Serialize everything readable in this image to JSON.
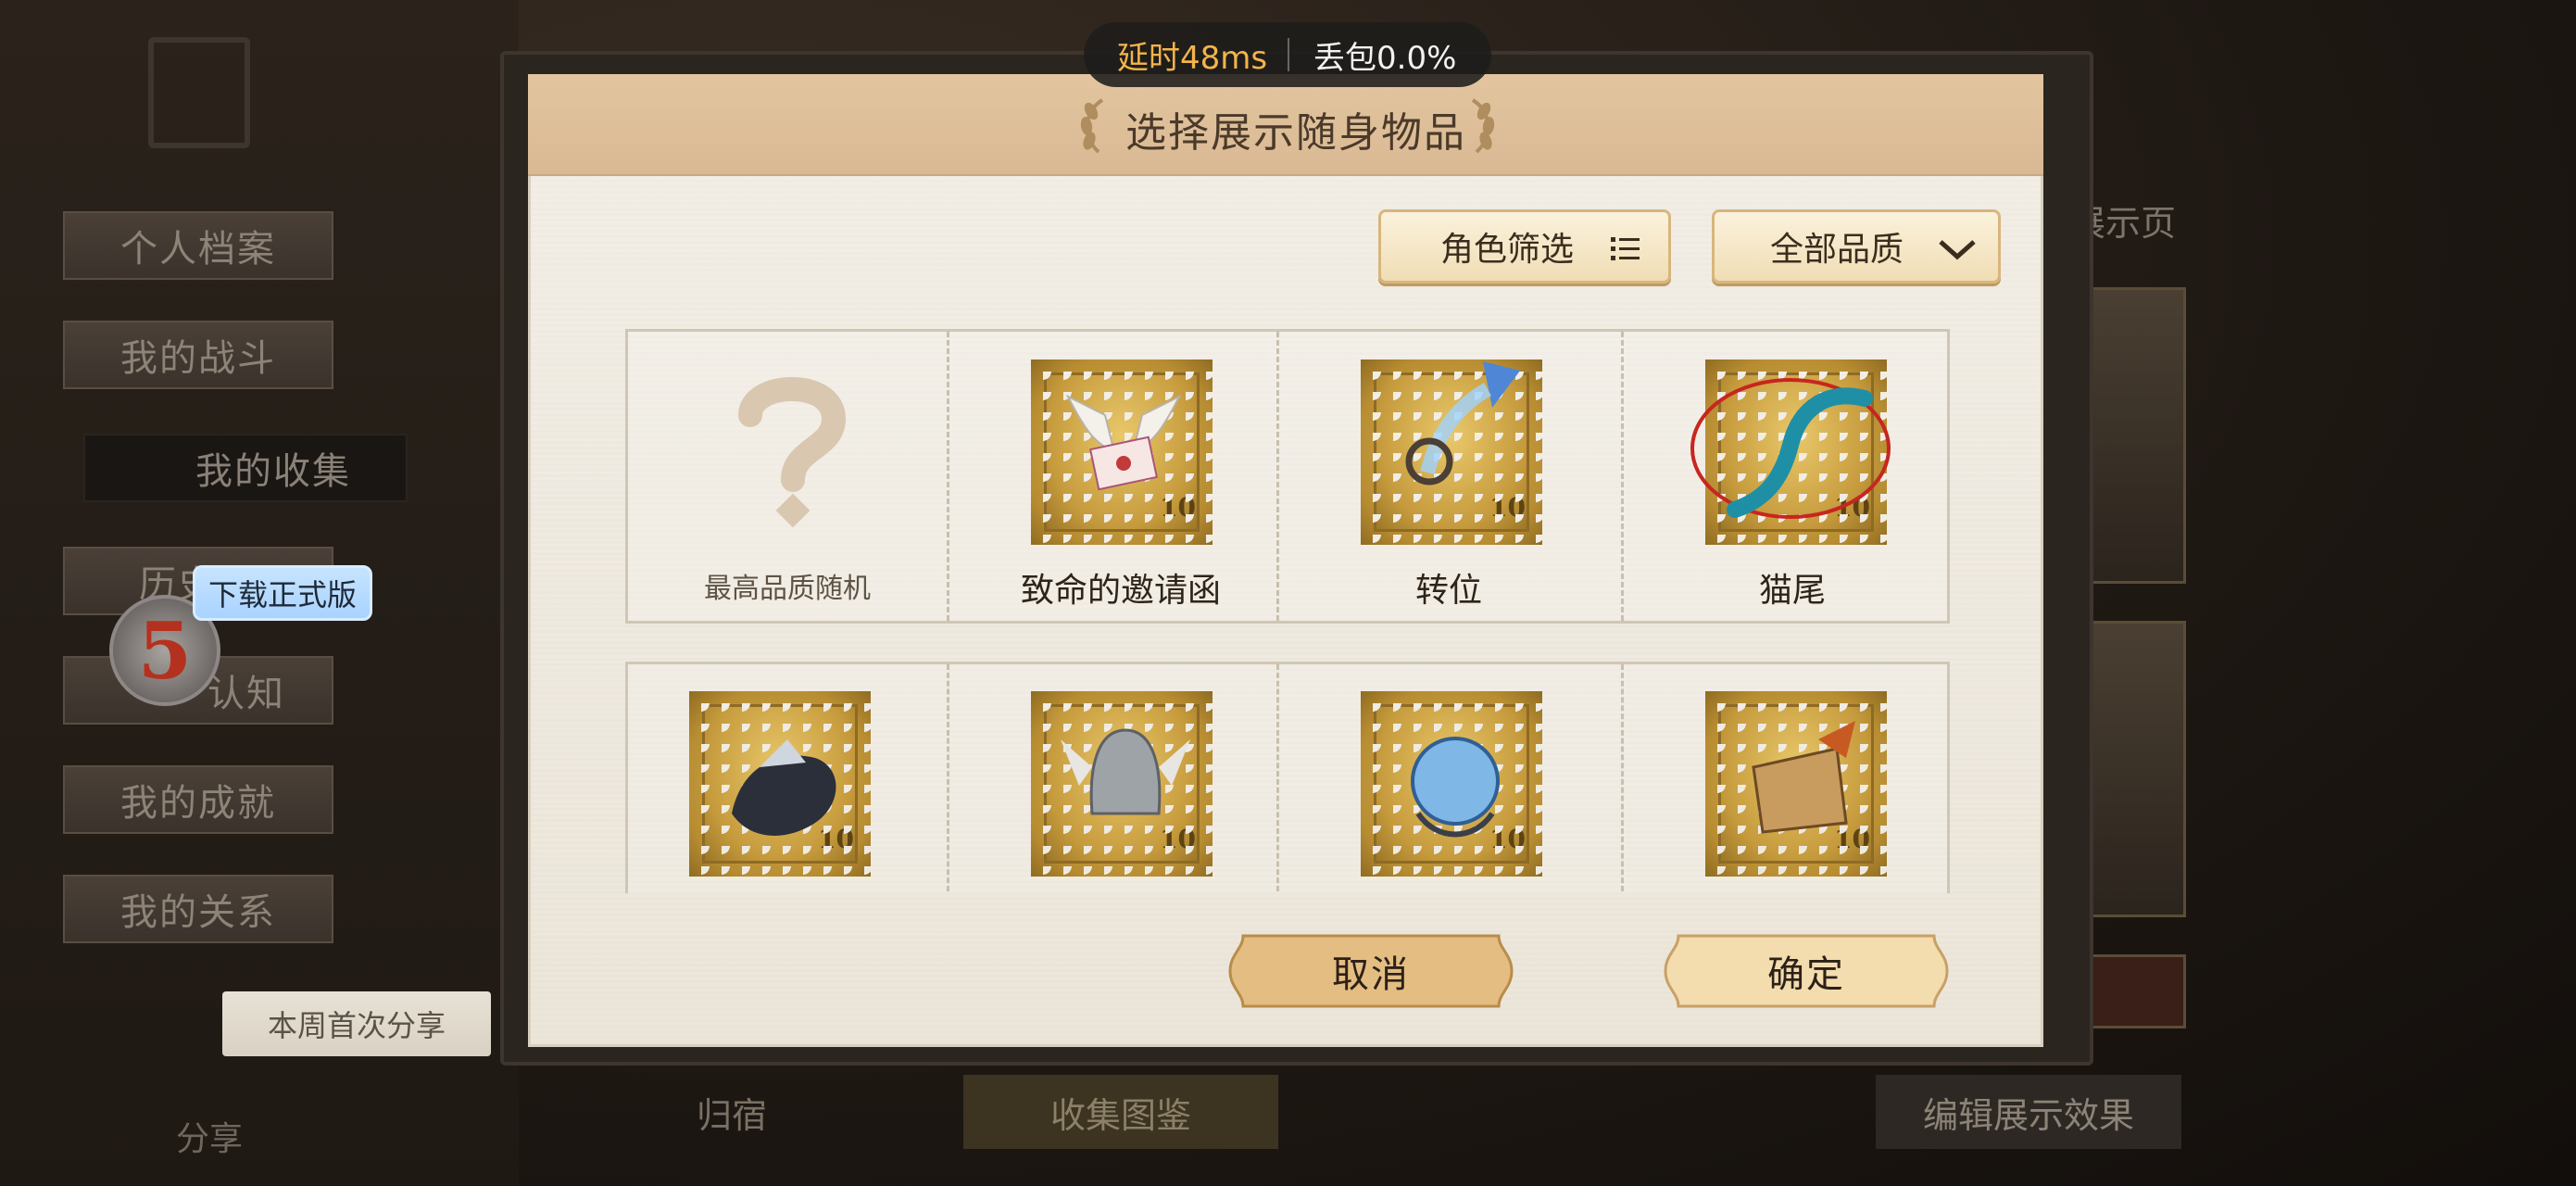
{
  "network": {
    "latency": "延时48ms",
    "packet_loss": "丢包0.0%"
  },
  "background": {
    "sidebar": [
      "个人档案",
      "我的战斗",
      "我的收集",
      "历史",
      "认知",
      "我的成就",
      "我的关系"
    ],
    "right_title": "展示页",
    "bottom_tabs": [
      "归宿",
      "收集图鉴",
      "编辑展示效果"
    ],
    "share_tag": "本周首次分享",
    "share_label": "分享",
    "download_badge": "下载正式版",
    "avatar_glyph": "5"
  },
  "dialog": {
    "title": "选择展示随身物品",
    "filter_role": "角色筛选",
    "filter_quality": "全部品质",
    "items": [
      {
        "label": "最高品质随机",
        "icon": "question-mark-icon"
      },
      {
        "label": "致命的邀请函",
        "icon": "winged-letter-icon"
      },
      {
        "label": "转位",
        "icon": "crystal-shard-icon"
      },
      {
        "label": "猫尾",
        "icon": "cat-tail-icon"
      },
      {
        "label": "",
        "icon": "beast-figure-icon"
      },
      {
        "label": "",
        "icon": "winged-helmet-icon"
      },
      {
        "label": "",
        "icon": "blue-orb-icon"
      },
      {
        "label": "",
        "icon": "scroll-icon"
      }
    ],
    "stamp_value": "10",
    "cancel": "取消",
    "confirm": "确定"
  },
  "colors": {
    "accent_gold": "#d7b67d",
    "latency": "#f2b54a",
    "parchment": "#f3efe7"
  }
}
